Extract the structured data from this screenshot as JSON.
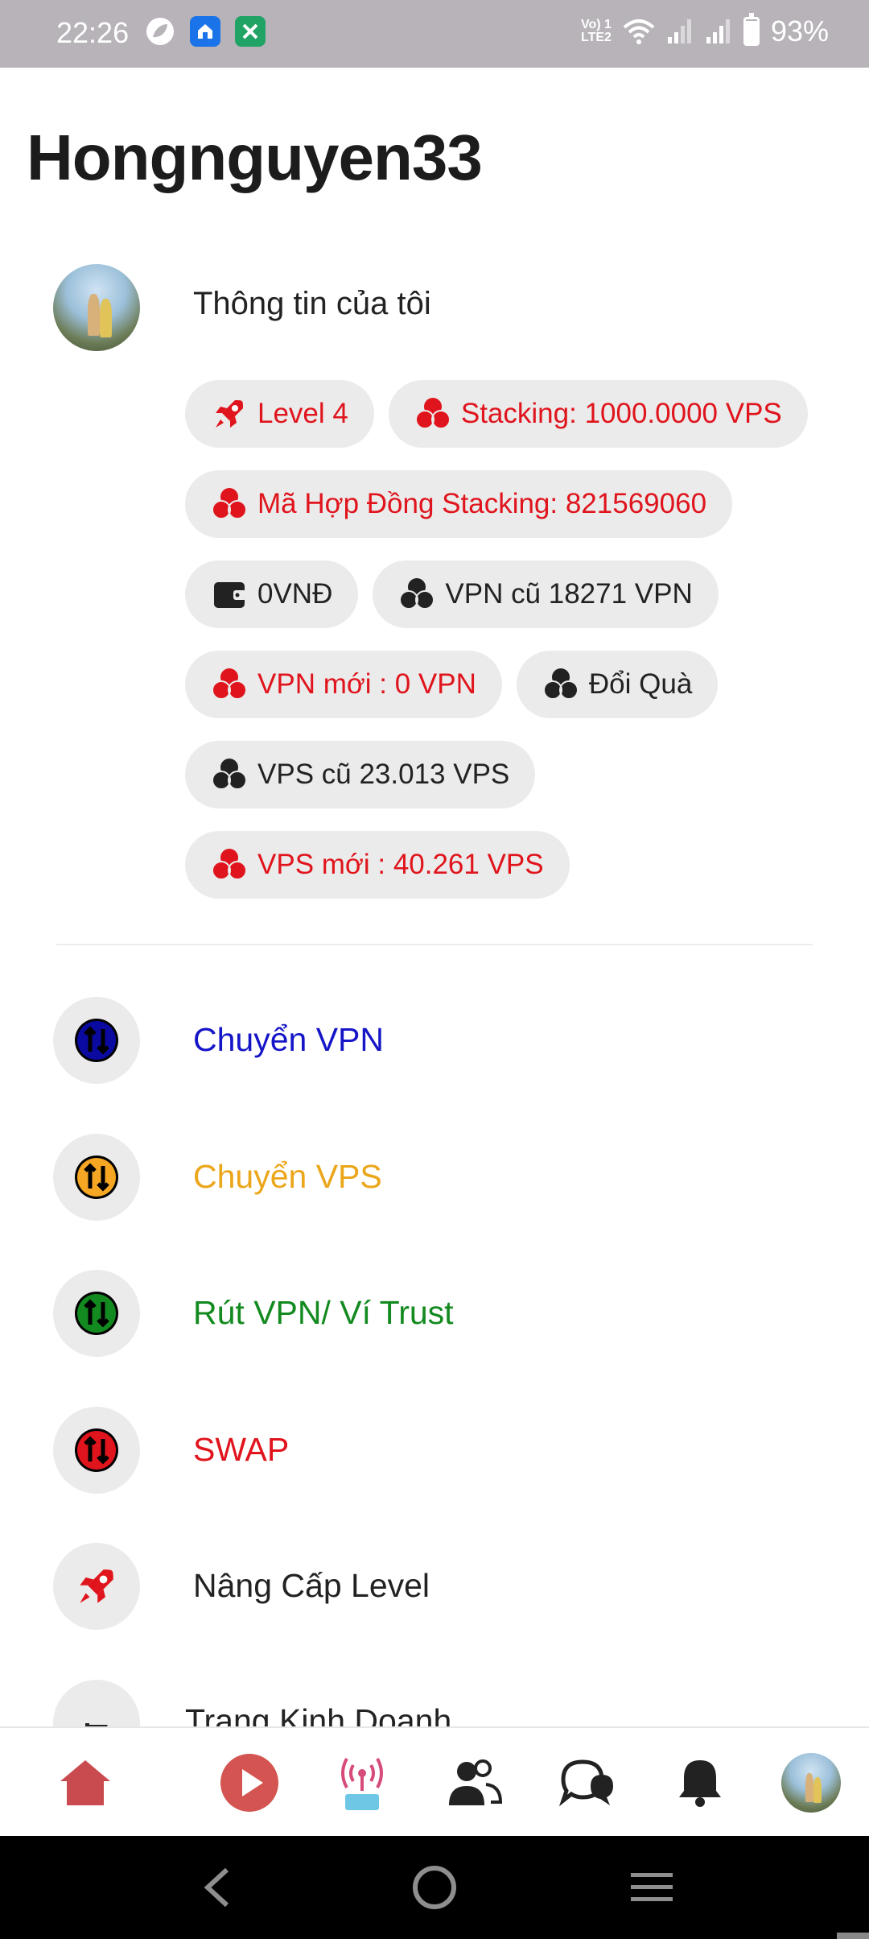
{
  "status_bar": {
    "time": "22:26",
    "volte": "Vo) 1\nLTE2",
    "battery": "93%",
    "battery_level": 0.93
  },
  "profile": {
    "username": "Hongnguyen33",
    "info_label": "Thông tin của tôi"
  },
  "chips": {
    "level": "Level 4",
    "stacking": "Stacking: 1000.0000 VPS",
    "contract": "Mã Hợp Đồng Stacking: 821569060",
    "wallet": "0VNĐ",
    "vpn_old": "VPN cũ 18271 VPN",
    "vpn_new": "VPN mới : 0 VPN",
    "gift": "Đổi Quà",
    "vps_old": "VPS cũ 23.013 VPS",
    "vps_new": "VPS mới : 40.261 VPS"
  },
  "menu": [
    {
      "label": "Chuyển VPN",
      "color": "#1515c8",
      "icon_bg": "#0a0a9a"
    },
    {
      "label": "Chuyển VPS",
      "color": "#eba61a",
      "icon_bg": "#f5a623"
    },
    {
      "label": "Rút VPN/ Ví Trust",
      "color": "#138a1f",
      "icon_bg": "#138a1f"
    },
    {
      "label": "SWAP",
      "color": "#e0141c",
      "icon_bg": "#e0141c"
    },
    {
      "label": "Nâng Cấp Level",
      "color": "#222222",
      "icon_bg": "#e0141c"
    },
    {
      "label": "Trang Kinh Doanh",
      "color": "#222222",
      "icon_bg": "#222222"
    }
  ],
  "bottom_nav": {
    "live_label": "LIVE"
  },
  "colors": {
    "accent_red": "#e0141c",
    "home_red": "#c94a4f",
    "chip_bg": "#ebebeb"
  }
}
